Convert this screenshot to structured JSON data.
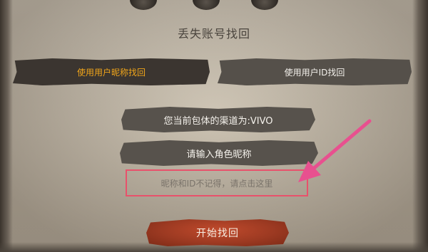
{
  "header": {
    "title": "丢失账号找回"
  },
  "tabs": [
    {
      "label": "使用用户昵称找回",
      "active": true,
      "active_color": "#f0a51a"
    },
    {
      "label": "使用用户ID找回",
      "active": false
    }
  ],
  "info": {
    "channel_text": "您当前包体的渠道为:VIVO"
  },
  "form": {
    "nickname_prompt": "请输入角色昵称"
  },
  "help": {
    "forgot_link": "昵称和ID不记得，请点击这里"
  },
  "actions": {
    "start_button": "开始找回",
    "start_color": "#a43d23"
  },
  "annotation": {
    "highlight_color": "#e8516b",
    "arrow_color": "#e8508f"
  }
}
